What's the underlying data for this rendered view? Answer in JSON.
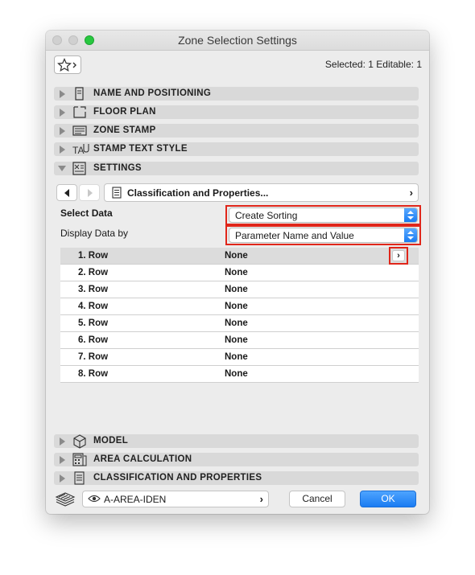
{
  "window": {
    "title": "Zone Selection Settings"
  },
  "header": {
    "selected_info": "Selected: 1 Editable: 1"
  },
  "sections_top": [
    {
      "label": "NAME AND POSITIONING",
      "icon": "name-positioning-icon"
    },
    {
      "label": "FLOOR PLAN",
      "icon": "floor-plan-icon"
    },
    {
      "label": "ZONE STAMP",
      "icon": "zone-stamp-icon"
    },
    {
      "label": "STAMP TEXT STYLE",
      "icon": "stamp-text-style-icon"
    },
    {
      "label": "SETTINGS",
      "icon": "settings-icon",
      "expanded": true
    }
  ],
  "settings_panel": {
    "classification_label": "Classification and Properties...",
    "select_data_label": "Select Data",
    "select_data_value": "Create Sorting",
    "display_by_label": "Display Data by",
    "display_by_value": "Parameter Name and Value",
    "rows": [
      {
        "name": "1. Row",
        "value": "None"
      },
      {
        "name": "2. Row",
        "value": "None"
      },
      {
        "name": "3. Row",
        "value": "None"
      },
      {
        "name": "4. Row",
        "value": "None"
      },
      {
        "name": "5. Row",
        "value": "None"
      },
      {
        "name": "6. Row",
        "value": "None"
      },
      {
        "name": "7. Row",
        "value": "None"
      },
      {
        "name": "8. Row",
        "value": "None"
      }
    ]
  },
  "sections_bottom": [
    {
      "label": "MODEL",
      "icon": "model-icon"
    },
    {
      "label": "AREA CALCULATION",
      "icon": "area-calculation-icon"
    },
    {
      "label": "CLASSIFICATION AND PROPERTIES",
      "icon": "classification-icon"
    }
  ],
  "footer": {
    "layer_value": "A-AREA-IDEN",
    "cancel_label": "Cancel",
    "ok_label": "OK"
  },
  "colors": {
    "highlight_outline": "#e0261a",
    "accent_blue": "#1a7cf2"
  }
}
